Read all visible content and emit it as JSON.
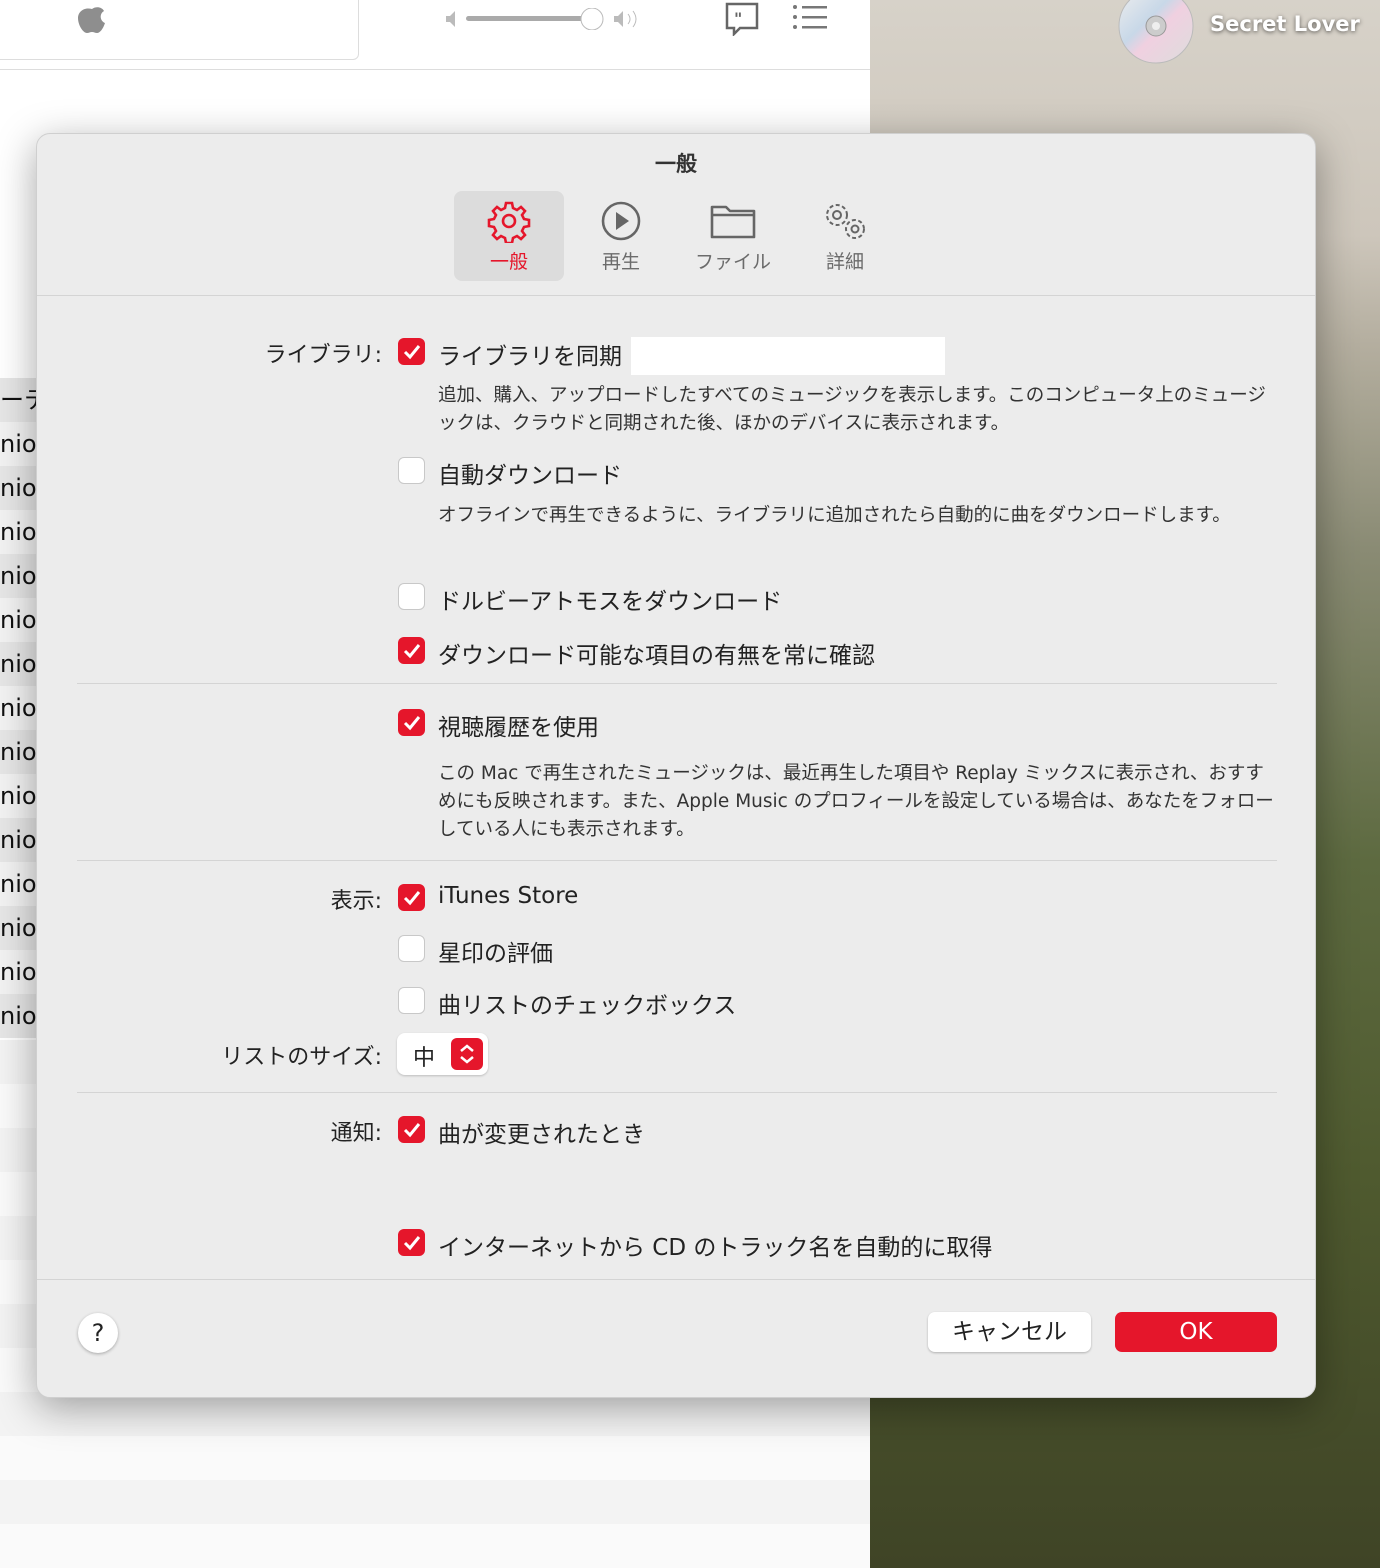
{
  "player": {
    "now_playing": "Secret Lover",
    "icons": [
      "apple-logo-icon",
      "volume-low-icon",
      "volume-slider",
      "volume-high-icon",
      "lyrics-icon",
      "queue-list-icon",
      "cd-artwork-icon"
    ],
    "volume_percent": 100
  },
  "background_list": {
    "rows": [
      "ーテ",
      "nior",
      "nior",
      "nior",
      "nior",
      "nior",
      "nior",
      "nior",
      "nior",
      "nior",
      "nior",
      "nior",
      "nior",
      "nior",
      "nior"
    ]
  },
  "dialog": {
    "title": "一般",
    "tabs": [
      {
        "label": "一般",
        "icon": "gear-icon",
        "selected": true
      },
      {
        "label": "再生",
        "icon": "play-circle-icon"
      },
      {
        "label": "ファイル",
        "icon": "folder-icon"
      },
      {
        "label": "詳細",
        "icon": "gears-icon"
      }
    ],
    "library": {
      "label": "ライブラリ:",
      "sync_label": "ライブラリを同期",
      "sync_checked": true,
      "sync_desc": "追加、購入、アップロードしたすべてのミュージックを表示します。このコンピュータ上のミュージックは、クラウドと同期された後、ほかのデバイスに表示されます。",
      "auto_download_label": "自動ダウンロード",
      "auto_download_checked": false,
      "auto_download_desc": "オフラインで再生できるように、ライブラリに追加されたら自動的に曲をダウンロードします。",
      "dolby_label": "ドルビーアトモスをダウンロード",
      "dolby_checked": false,
      "check_downloads_label": "ダウンロード可能な項目の有無を常に確認",
      "check_downloads_checked": true
    },
    "history": {
      "label": "視聴履歴を使用",
      "checked": true,
      "desc": "この Mac で再生されたミュージックは、最近再生した項目や Replay ミックスに表示され、おすすめにも反映されます。また、Apple Music のプロフィールを設定している場合は、あなたをフォローしている人にも表示されます。"
    },
    "display": {
      "label": "表示:",
      "itunes_label": "iTunes Store",
      "itunes_checked": true,
      "stars_label": "星印の評価",
      "stars_checked": false,
      "checkboxes_label": "曲リストのチェックボックス",
      "checkboxes_checked": false
    },
    "list_size": {
      "label": "リストのサイズ:",
      "value": "中"
    },
    "notifications": {
      "label": "通知:",
      "song_change_label": "曲が変更されたとき",
      "song_change_checked": true
    },
    "cd": {
      "label": "インターネットから CD のトラック名を自動的に取得",
      "checked": true
    },
    "help_label": "?",
    "cancel_label": "キャンセル",
    "ok_label": "OK",
    "accent": "#e5162b"
  }
}
